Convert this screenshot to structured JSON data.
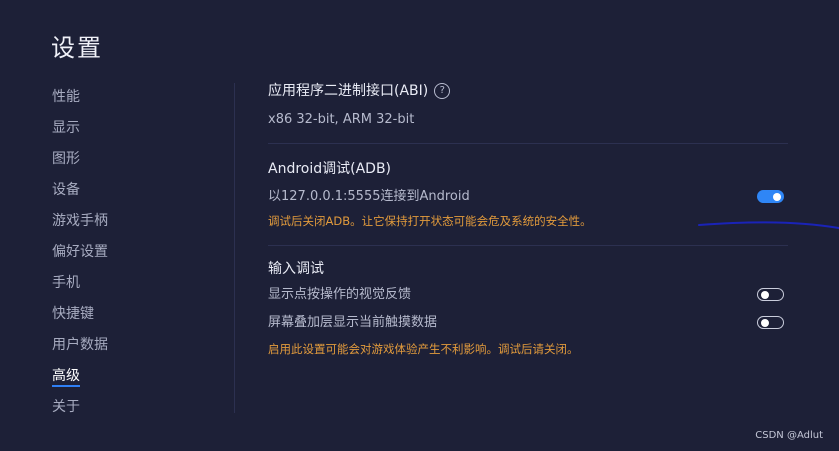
{
  "page_title": "设置",
  "sidebar": {
    "items": [
      {
        "label": "性能"
      },
      {
        "label": "显示"
      },
      {
        "label": "图形"
      },
      {
        "label": "设备"
      },
      {
        "label": "游戏手柄"
      },
      {
        "label": "偏好设置"
      },
      {
        "label": "手机"
      },
      {
        "label": "快捷键"
      },
      {
        "label": "用户数据"
      },
      {
        "label": "高级"
      },
      {
        "label": "关于"
      }
    ],
    "active_index": 9
  },
  "abi": {
    "title": "应用程序二进制接口(ABI)",
    "help_icon": "question-circle-icon",
    "help_glyph": "?",
    "value": "x86 32-bit, ARM 32-bit"
  },
  "adb": {
    "title": "Android调试(ADB)",
    "connect_label": "以127.0.0.1:5555连接到Android",
    "toggle_on": true,
    "warning": "调试后关闭ADB。让它保持打开状态可能会危及系统的安全性。"
  },
  "input_debug": {
    "title": "输入调试",
    "items": [
      {
        "label": "显示点按操作的视觉反馈",
        "toggle_on": false
      },
      {
        "label": "屏幕叠加层显示当前触摸数据",
        "toggle_on": false
      }
    ],
    "warning": "启用此设置可能会对游戏体验产生不利影响。调试后请关闭。"
  },
  "colors": {
    "background": "#1d2037",
    "accent": "#2f86f6",
    "warning": "#e39b3c",
    "annotation_line": "#1a23b8"
  },
  "watermark": "CSDN @Adlut"
}
